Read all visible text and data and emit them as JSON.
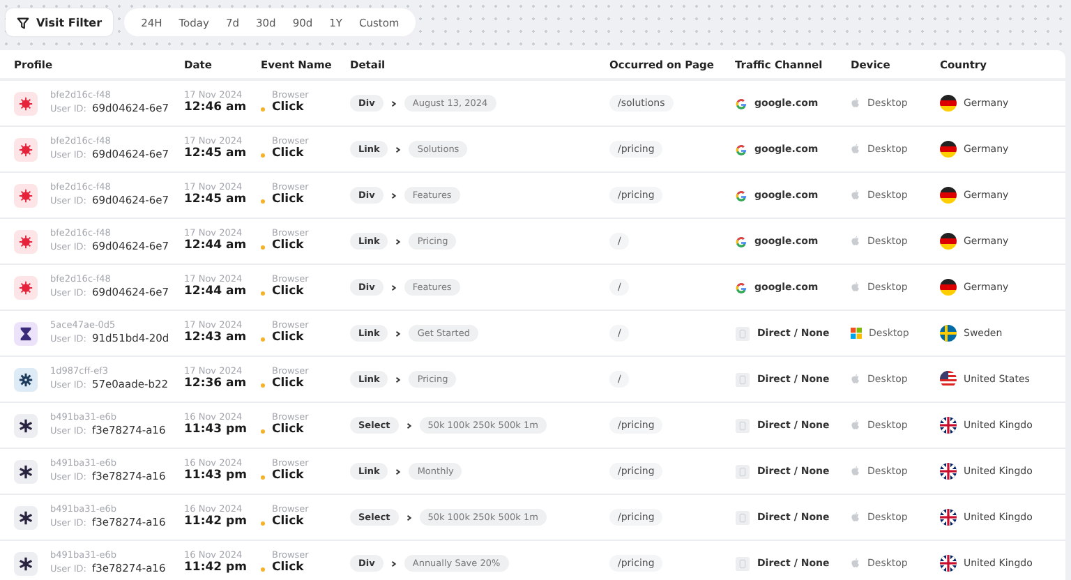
{
  "filter_button": {
    "label": "Visit Filter"
  },
  "ranges": [
    {
      "label": "24H",
      "selected": false
    },
    {
      "label": "Today",
      "selected": false
    },
    {
      "label": "7d",
      "selected": false
    },
    {
      "label": "30d",
      "selected": false
    },
    {
      "label": "90d",
      "selected": false
    },
    {
      "label": "1Y",
      "selected": false
    },
    {
      "label": "Custom",
      "selected": false
    }
  ],
  "table": {
    "columns": [
      "Profile",
      "Date",
      "Event Name",
      "Detail",
      "Occurred on Page",
      "Traffic Channel",
      "Device",
      "Country"
    ],
    "rows": [
      {
        "avatar": {
          "kind": "burst"
        },
        "profile_id": "bfe2d16c-f48",
        "user_label": "User ID:",
        "user_id": "69d04624-6e7",
        "date": "17 Nov 2024",
        "time": "12:46 am",
        "event_source": "Browser",
        "event": "Click",
        "element": "Div",
        "target": "August 13, 2024",
        "page": "/solutions",
        "channel": {
          "kind": "google",
          "label": "google.com"
        },
        "device": {
          "kind": "apple",
          "label": "Desktop"
        },
        "country": {
          "kind": "de",
          "name": "Germany"
        }
      },
      {
        "avatar": {
          "kind": "burst"
        },
        "profile_id": "bfe2d16c-f48",
        "user_label": "User ID:",
        "user_id": "69d04624-6e7",
        "date": "17 Nov 2024",
        "time": "12:45 am",
        "event_source": "Browser",
        "event": "Click",
        "element": "Link",
        "target": "Solutions",
        "page": "/pricing",
        "channel": {
          "kind": "google",
          "label": "google.com"
        },
        "device": {
          "kind": "apple",
          "label": "Desktop"
        },
        "country": {
          "kind": "de",
          "name": "Germany"
        }
      },
      {
        "avatar": {
          "kind": "burst"
        },
        "profile_id": "bfe2d16c-f48",
        "user_label": "User ID:",
        "user_id": "69d04624-6e7",
        "date": "17 Nov 2024",
        "time": "12:45 am",
        "event_source": "Browser",
        "event": "Click",
        "element": "Div",
        "target": "Features",
        "page": "/pricing",
        "channel": {
          "kind": "google",
          "label": "google.com"
        },
        "device": {
          "kind": "apple",
          "label": "Desktop"
        },
        "country": {
          "kind": "de",
          "name": "Germany"
        }
      },
      {
        "avatar": {
          "kind": "burst"
        },
        "profile_id": "bfe2d16c-f48",
        "user_label": "User ID:",
        "user_id": "69d04624-6e7",
        "date": "17 Nov 2024",
        "time": "12:44 am",
        "event_source": "Browser",
        "event": "Click",
        "element": "Link",
        "target": "Pricing",
        "page": "/",
        "channel": {
          "kind": "google",
          "label": "google.com"
        },
        "device": {
          "kind": "apple",
          "label": "Desktop"
        },
        "country": {
          "kind": "de",
          "name": "Germany"
        }
      },
      {
        "avatar": {
          "kind": "burst"
        },
        "profile_id": "bfe2d16c-f48",
        "user_label": "User ID:",
        "user_id": "69d04624-6e7",
        "date": "17 Nov 2024",
        "time": "12:44 am",
        "event_source": "Browser",
        "event": "Click",
        "element": "Div",
        "target": "Features",
        "page": "/",
        "channel": {
          "kind": "google",
          "label": "google.com"
        },
        "device": {
          "kind": "apple",
          "label": "Desktop"
        },
        "country": {
          "kind": "de",
          "name": "Germany"
        }
      },
      {
        "avatar": {
          "kind": "hourglass"
        },
        "profile_id": "5ace47ae-0d5",
        "user_label": "User ID:",
        "user_id": "91d51bd4-20d",
        "date": "17 Nov 2024",
        "time": "12:43 am",
        "event_source": "Browser",
        "event": "Click",
        "element": "Link",
        "target": "Get Started",
        "page": "/",
        "channel": {
          "kind": "direct",
          "label": "Direct / None"
        },
        "device": {
          "kind": "windows",
          "label": "Desktop"
        },
        "country": {
          "kind": "se",
          "name": "Sweden"
        }
      },
      {
        "avatar": {
          "kind": "gear"
        },
        "profile_id": "1d987cff-ef3",
        "user_label": "User ID:",
        "user_id": "57e0aade-b22",
        "date": "17 Nov 2024",
        "time": "12:36 am",
        "event_source": "Browser",
        "event": "Click",
        "element": "Link",
        "target": "Pricing",
        "page": "/",
        "channel": {
          "kind": "direct",
          "label": "Direct / None"
        },
        "device": {
          "kind": "apple",
          "label": "Desktop"
        },
        "country": {
          "kind": "us",
          "name": "United States"
        }
      },
      {
        "avatar": {
          "kind": "asterisk"
        },
        "profile_id": "b491ba31-e6b",
        "user_label": "User ID:",
        "user_id": "f3e78274-a16",
        "date": "16 Nov 2024",
        "time": "11:43 pm",
        "event_source": "Browser",
        "event": "Click",
        "element": "Select",
        "target": "50k 100k 250k 500k 1m",
        "page": "/pricing",
        "channel": {
          "kind": "direct",
          "label": "Direct / None"
        },
        "device": {
          "kind": "apple",
          "label": "Desktop"
        },
        "country": {
          "kind": "gb",
          "name": "United Kingdo"
        }
      },
      {
        "avatar": {
          "kind": "asterisk"
        },
        "profile_id": "b491ba31-e6b",
        "user_label": "User ID:",
        "user_id": "f3e78274-a16",
        "date": "16 Nov 2024",
        "time": "11:43 pm",
        "event_source": "Browser",
        "event": "Click",
        "element": "Link",
        "target": "Monthly",
        "page": "/pricing",
        "channel": {
          "kind": "direct",
          "label": "Direct / None"
        },
        "device": {
          "kind": "apple",
          "label": "Desktop"
        },
        "country": {
          "kind": "gb",
          "name": "United Kingdo"
        }
      },
      {
        "avatar": {
          "kind": "asterisk"
        },
        "profile_id": "b491ba31-e6b",
        "user_label": "User ID:",
        "user_id": "f3e78274-a16",
        "date": "16 Nov 2024",
        "time": "11:42 pm",
        "event_source": "Browser",
        "event": "Click",
        "element": "Select",
        "target": "50k 100k 250k 500k 1m",
        "page": "/pricing",
        "channel": {
          "kind": "direct",
          "label": "Direct / None"
        },
        "device": {
          "kind": "apple",
          "label": "Desktop"
        },
        "country": {
          "kind": "gb",
          "name": "United Kingdo"
        }
      },
      {
        "avatar": {
          "kind": "asterisk"
        },
        "profile_id": "b491ba31-e6b",
        "user_label": "User ID:",
        "user_id": "f3e78274-a16",
        "date": "16 Nov 2024",
        "time": "11:42 pm",
        "event_source": "Browser",
        "event": "Click",
        "element": "Div",
        "target": "Annually Save 20%",
        "page": "/pricing",
        "channel": {
          "kind": "direct",
          "label": "Direct / None"
        },
        "device": {
          "kind": "apple",
          "label": "Desktop"
        },
        "country": {
          "kind": "gb",
          "name": "United Kingdo"
        }
      }
    ]
  }
}
